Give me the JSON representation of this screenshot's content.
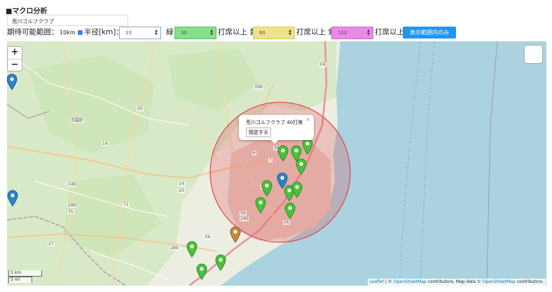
{
  "page": {
    "title": "■マクロ分析"
  },
  "place": {
    "value": "荒川ゴルフクラブ"
  },
  "controls": {
    "expected_label": "期待可能範囲：",
    "expected_value": "10km",
    "radius_label": "半径[km]：",
    "radius_value": "10",
    "green_label": "緑",
    "green_value": "30",
    "green_suffix": "打席以上 黄",
    "yellow_value": "60",
    "yellow_suffix": "打席以上 紫",
    "purple_value": "100",
    "purple_suffix": "打席以上",
    "view_button": "表示範囲内のみ"
  },
  "colors": {
    "green": "#86e08a",
    "yellow": "#eee38a",
    "purple": "#e98ae9",
    "accent": "#2196f3",
    "circle": "#e0444d",
    "sea": "#aad3df"
  },
  "map": {
    "zoom_in": "+",
    "zoom_out": "−",
    "popup_title": "荒川ゴルフクラブ 40打席",
    "popup_button": "指定する",
    "popup_close": "×",
    "scale_km": "5 km",
    "scale_mi": "3 mi",
    "attribution_leaflet": "Leaflet",
    "attribution_sep": " | © ",
    "attribution_osm1": "OpenStreetMap",
    "attribution_mid": " contributors, Map data © ",
    "attribution_osm2": "OpenStreetMap",
    "attribution_end": " contributors,",
    "labels": [
      "E6",
      "399",
      "20",
      "古殿町",
      "14",
      "14",
      "20",
      "349",
      "289",
      "35",
      "71",
      "49",
      "56",
      "240",
      "26",
      "E6",
      "27",
      "289",
      "6",
      "7",
      "36"
    ],
    "markers": [
      {
        "color": "green"
      },
      {
        "color": "green"
      },
      {
        "color": "green"
      },
      {
        "color": "green"
      },
      {
        "color": "blue"
      },
      {
        "color": "green"
      },
      {
        "color": "green"
      },
      {
        "color": "green"
      },
      {
        "color": "green"
      },
      {
        "color": "green"
      },
      {
        "color": "orange"
      },
      {
        "color": "green"
      },
      {
        "color": "green"
      },
      {
        "color": "green"
      },
      {
        "color": "blue"
      },
      {
        "color": "blue"
      }
    ]
  }
}
